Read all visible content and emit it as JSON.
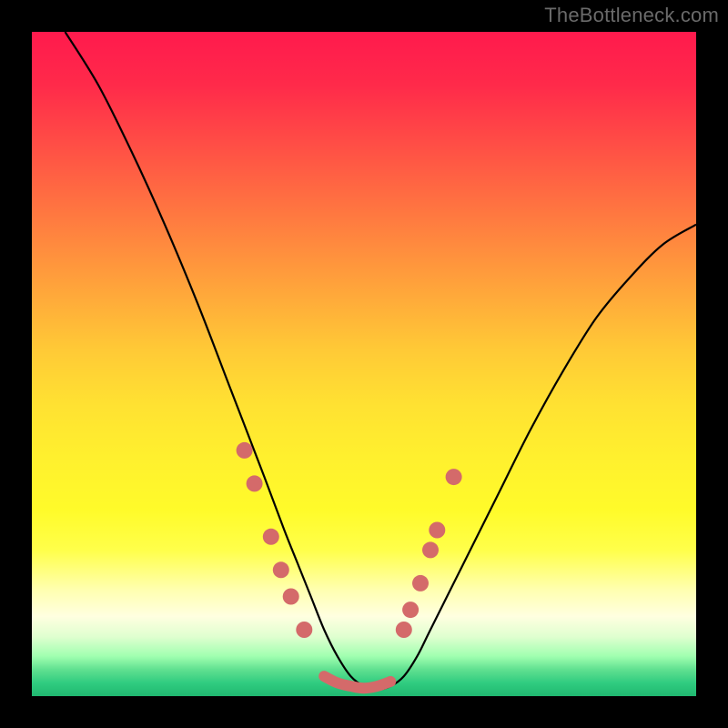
{
  "watermark": "TheBottleneck.com",
  "chart_data": {
    "type": "line",
    "title": "",
    "xlabel": "",
    "ylabel": "",
    "ylim": [
      0,
      100
    ],
    "xlim": [
      0,
      100
    ],
    "series": [
      {
        "name": "curve",
        "x": [
          5,
          10,
          15,
          20,
          25,
          30,
          35,
          38,
          40,
          42,
          44,
          46,
          48,
          50,
          52,
          54,
          56,
          58,
          60,
          65,
          70,
          75,
          80,
          85,
          90,
          95,
          100
        ],
        "y": [
          100,
          92,
          82,
          71,
          59,
          46,
          33,
          25,
          20,
          15,
          10,
          6,
          3,
          1.5,
          1,
          1.5,
          3,
          6,
          10,
          20,
          30,
          40,
          49,
          57,
          63,
          68,
          71
        ]
      },
      {
        "name": "markers-left",
        "x": [
          32,
          33.5,
          36,
          37.5,
          39,
          41
        ],
        "y": [
          37,
          32,
          24,
          19,
          15,
          10
        ]
      },
      {
        "name": "markers-right",
        "x": [
          56,
          57,
          58.5,
          60,
          61,
          63.5
        ],
        "y": [
          10,
          13,
          17,
          22,
          25,
          33
        ]
      },
      {
        "name": "valley-segment",
        "x": [
          44,
          46,
          48,
          50,
          52,
          54
        ],
        "y": [
          3,
          2,
          1.5,
          1.2,
          1.5,
          2.2
        ]
      }
    ],
    "marker_color": "#d46a6a",
    "line_color": "#000000"
  }
}
